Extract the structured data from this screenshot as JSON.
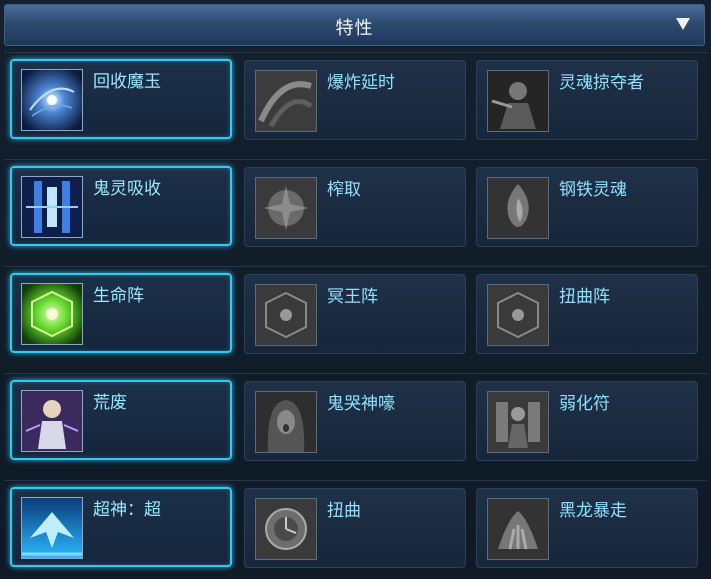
{
  "header": {
    "title": "特性"
  },
  "rows": [
    [
      "回收魔玉",
      "爆炸延时",
      "灵魂掠夺者"
    ],
    [
      "鬼灵吸收",
      "榨取",
      "钢铁灵魂"
    ],
    [
      "生命阵",
      "冥王阵",
      "扭曲阵"
    ],
    [
      "荒废",
      "鬼哭神嚎",
      "弱化符"
    ],
    [
      "超神：超",
      "扭曲",
      "黑龙暴走"
    ]
  ],
  "icons": [
    [
      "galaxy-icon",
      "swirl-icon",
      "ninja-icon"
    ],
    [
      "soul-pillars-icon",
      "energy-burst-icon",
      "spirit-flame-icon"
    ],
    [
      "life-circle-icon",
      "pluto-circle-icon",
      "twist-circle-icon"
    ],
    [
      "character-icon",
      "weeping-ghost-icon",
      "weakening-seal-icon"
    ],
    [
      "phoenix-icon",
      "clock-dial-icon",
      "dragon-claw-icon"
    ]
  ],
  "colors": {
    "accent": "#34c9f0",
    "label": "#8fe0ff",
    "header": "#2d4a70"
  }
}
